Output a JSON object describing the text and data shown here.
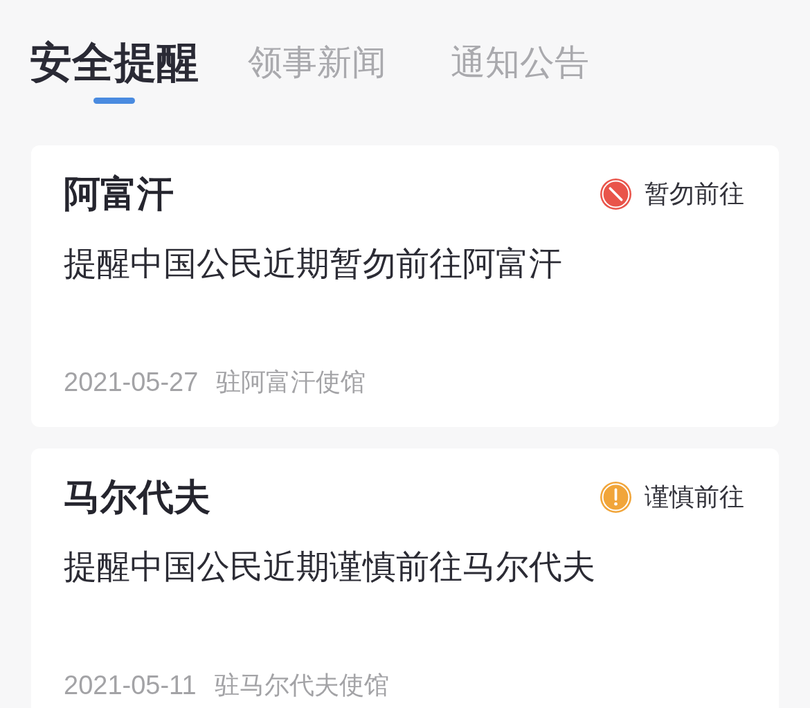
{
  "tabs": [
    {
      "label": "安全提醒",
      "selected": true
    },
    {
      "label": "领事新闻",
      "selected": false
    },
    {
      "label": "通知公告",
      "selected": false
    }
  ],
  "alerts": [
    {
      "country": "阿富汗",
      "status": {
        "kind": "prohibited",
        "color": "#e9544a",
        "label": "暂勿前往"
      },
      "message": "提醒中国公民近期暂勿前往阿富汗",
      "date": "2021-05-27",
      "source": "驻阿富汗使馆"
    },
    {
      "country": "马尔代夫",
      "status": {
        "kind": "caution",
        "color": "#f1a53a",
        "label": "谨慎前往"
      },
      "message": "提醒中国公民近期谨慎前往马尔代夫",
      "date": "2021-05-11",
      "source": "驻马尔代夫使馆"
    }
  ]
}
